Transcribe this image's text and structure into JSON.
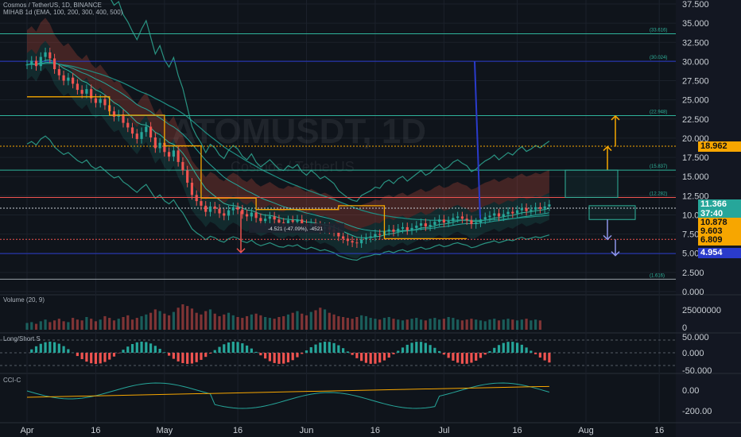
{
  "header": {
    "symbol_line": "Cosmos / TetherUS, 1D, BINANCE",
    "indicator_line": "MIHAB 1d (EMA, 100, 200, 300, 400, 500)"
  },
  "watermark": {
    "ticker": "ATOMUSDT, 1D",
    "name": "Cosmos / TetherUS"
  },
  "panes": {
    "volume": {
      "title": "Volume (20, 9)",
      "axis_labels": [
        "25000000",
        "0"
      ]
    },
    "longshort": {
      "title": "Long/Short S",
      "axis_labels": [
        "50.000",
        "0.000",
        "-50.000"
      ]
    },
    "cci": {
      "title": "CCI-C",
      "axis_labels": [
        "0.00",
        "-200.00"
      ]
    }
  },
  "price_tags": {
    "last_price": "11.366",
    "countdown": "37:40",
    "target": "18.962",
    "level_a": "10.878",
    "level_b": "9.603",
    "level_c": "6.809",
    "stop": "4.954"
  },
  "measure_label": "-4.521 (-47.09%), -4521",
  "fib_labels": [
    {
      "text": "(33.616)",
      "price": 33.616
    },
    {
      "text": "(30.024)",
      "price": 30.024
    },
    {
      "text": "(22.948)",
      "price": 22.948
    },
    {
      "text": "(15.837)",
      "price": 15.837
    },
    {
      "text": "(12.282)",
      "price": 12.282
    },
    {
      "text": "(1.616)",
      "price": 1.616
    }
  ],
  "colors": {
    "up": "#26a69a",
    "down": "#ef5350",
    "accent": "#f7a600",
    "blue": "#2a3bcb",
    "line": "#2fb39b"
  },
  "chart_data": {
    "type": "candlestick",
    "title": "ATOMUSDT, 1D",
    "x_axis": {
      "tick_labels": [
        "Apr",
        "16",
        "May",
        "16",
        "Jun",
        "16",
        "Jul",
        "16",
        "Aug",
        "16"
      ],
      "tick_days": [
        0,
        15,
        30,
        46,
        61,
        76,
        91,
        107,
        122,
        138
      ]
    },
    "y_axis": {
      "tick_labels": [
        "37.500",
        "35.000",
        "32.500",
        "30.000",
        "27.500",
        "25.000",
        "22.500",
        "20.000",
        "17.500",
        "15.000",
        "12.500",
        "10.000",
        "7.500",
        "5.000",
        "2.500",
        "0.000"
      ],
      "ylim": [
        0,
        37.5
      ]
    },
    "horizontal_levels": [
      33.616,
      30.024,
      22.948,
      18.962,
      15.837,
      12.282,
      10.878,
      6.809,
      4.954,
      1.616
    ],
    "close_series": [
      29.6,
      30.1,
      29.4,
      30.6,
      31.2,
      30.4,
      29.0,
      28.2,
      27.5,
      27.9,
      27.1,
      26.3,
      25.8,
      26.4,
      25.2,
      24.6,
      25.1,
      24.3,
      23.5,
      22.8,
      23.1,
      22.0,
      21.4,
      20.6,
      19.9,
      20.8,
      21.5,
      20.1,
      18.7,
      19.4,
      18.2,
      17.6,
      18.4,
      16.9,
      15.8,
      14.2,
      12.6,
      11.8,
      11.2,
      10.4,
      11.1,
      10.8,
      10.2,
      9.9,
      10.6,
      11.0,
      10.7,
      10.1,
      9.8,
      10.3,
      9.6,
      9.2,
      9.5,
      9.8,
      9.4,
      9.0,
      8.9,
      9.3,
      9.1,
      9.4,
      8.8,
      8.5,
      8.9,
      8.6,
      8.2,
      8.4,
      8.1,
      7.8,
      7.2,
      6.9,
      6.6,
      6.4,
      6.3,
      6.8,
      7.0,
      7.2,
      7.5,
      7.4,
      7.9,
      8.1,
      7.8,
      8.2,
      8.4,
      8.0,
      8.3,
      8.6,
      8.9,
      8.5,
      8.7,
      9.1,
      9.4,
      9.0,
      9.2,
      9.6,
      9.8,
      9.5,
      9.3,
      8.8,
      9.0,
      9.4,
      9.7,
      9.9,
      10.2,
      9.8,
      10.1,
      10.4,
      10.2,
      10.6,
      10.9,
      10.5,
      10.7,
      11.0,
      10.8,
      11.1,
      11.366
    ],
    "volume_series": [
      8,
      9,
      7,
      10,
      12,
      9,
      11,
      13,
      10,
      9,
      14,
      12,
      11,
      15,
      13,
      10,
      12,
      16,
      14,
      11,
      13,
      15,
      17,
      12,
      14,
      16,
      18,
      20,
      24,
      22,
      19,
      17,
      21,
      26,
      30,
      28,
      25,
      20,
      18,
      22,
      24,
      19,
      16,
      18,
      20,
      17,
      15,
      14,
      16,
      18,
      19,
      17,
      15,
      14,
      13,
      15,
      16,
      18,
      20,
      22,
      19,
      17,
      21,
      23,
      26,
      24,
      20,
      18,
      16,
      15,
      14,
      13,
      15,
      17,
      16,
      14,
      13,
      12,
      14,
      15,
      13,
      12,
      11,
      12,
      13,
      14,
      12,
      11,
      13,
      14,
      12,
      13,
      15,
      14,
      12,
      11,
      12,
      13,
      12,
      11,
      10,
      12,
      13,
      11,
      12,
      13,
      12,
      11,
      12,
      13,
      11,
      12,
      11
    ]
  }
}
